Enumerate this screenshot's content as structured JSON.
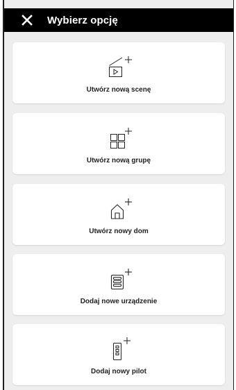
{
  "header": {
    "title": "Wybierz opcję",
    "close_icon": "close-icon"
  },
  "options": [
    {
      "label": "Utwórz nową scenę",
      "icon": "add-scene-icon"
    },
    {
      "label": "Utwórz nową grupę",
      "icon": "add-group-icon"
    },
    {
      "label": "Utwórz nowy dom",
      "icon": "add-home-icon"
    },
    {
      "label": "Dodaj nowe urządzenie",
      "icon": "add-device-icon"
    },
    {
      "label": "Dodaj nowy pilot",
      "icon": "add-remote-icon"
    }
  ],
  "colors": {
    "header_bg": "#000000",
    "header_text": "#ffffff",
    "page_bg": "#eeeeee",
    "card_bg": "#ffffff"
  }
}
